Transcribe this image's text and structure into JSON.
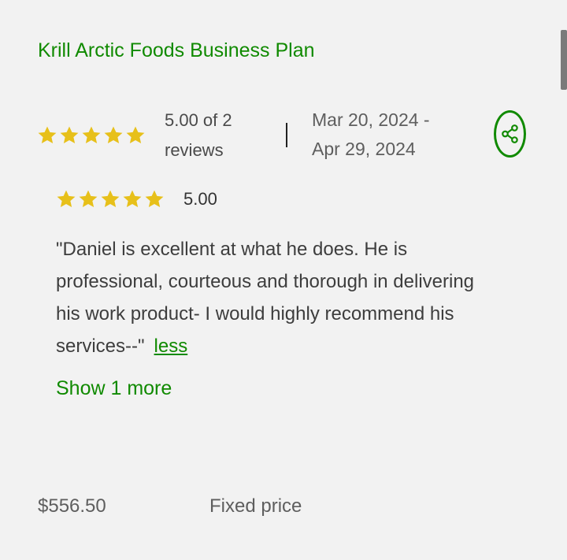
{
  "job": {
    "title": "Krill Arctic Foods Business Plan",
    "rating_stars": 5,
    "rating_summary_line1": "5.00 of 2",
    "rating_summary_line2": "reviews",
    "date_start": "Mar 20, 2024 -",
    "date_end": "Apr 29, 2024",
    "share_icon": "share-icon"
  },
  "review": {
    "rating_stars": 5,
    "score": "5.00",
    "text": "\"Daniel is excellent at what he does. He is professional, courteous and thorough in delivering his work product- I would highly recommend his services--\"",
    "less_label": "less",
    "show_more_label": "Show 1 more"
  },
  "pricing": {
    "amount": "$556.50",
    "type": "Fixed price"
  },
  "colors": {
    "accent": "#108a00",
    "star": "#e7c01a",
    "background": "#f2f2f2"
  }
}
